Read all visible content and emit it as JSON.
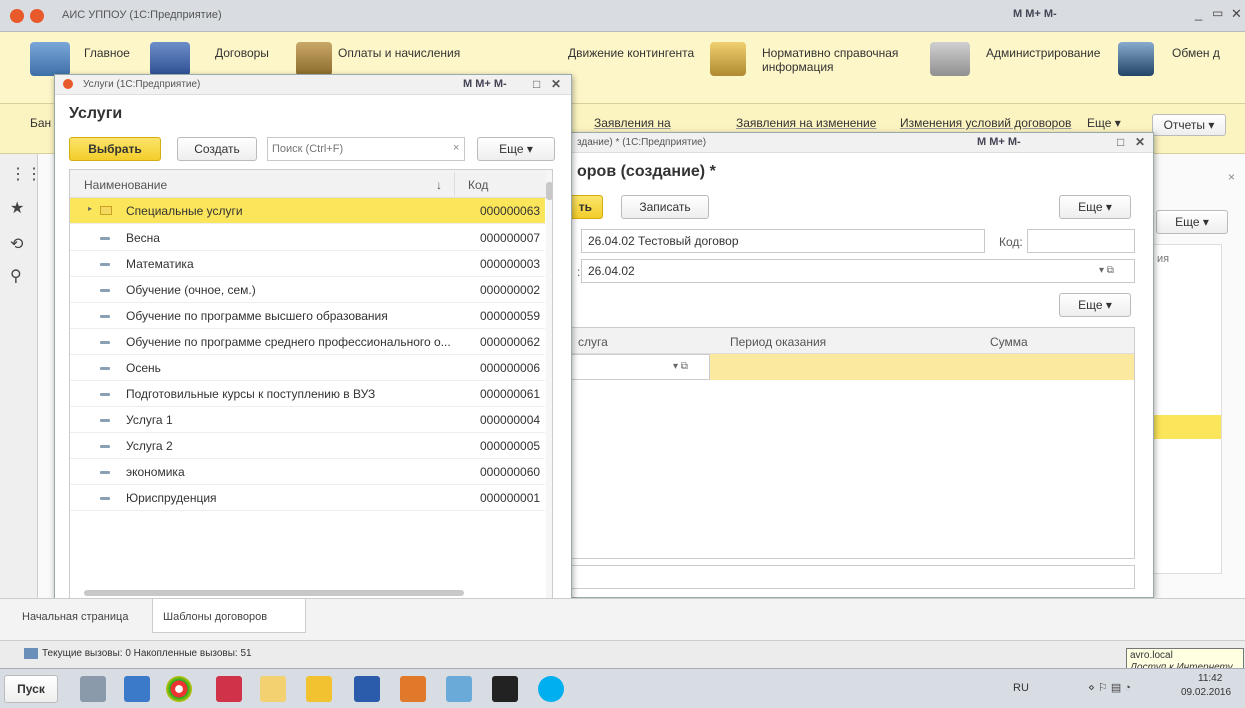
{
  "app": {
    "title": "АИС УППОУ (1С:Предприятие)",
    "toolbar_mm": "M  M+ M-"
  },
  "sections": [
    {
      "label": "Главное"
    },
    {
      "label": "Договоры"
    },
    {
      "label": "Оплаты и начисления"
    },
    {
      "label": "Движение контингента"
    },
    {
      "label": "Нормативно справочная информация"
    },
    {
      "label": "Администрирование"
    },
    {
      "label": "Обмен д"
    }
  ],
  "subbar": {
    "left_label": "Бан",
    "links": [
      "Заявления на",
      "Заявления на изменение",
      "Изменения условий договоров",
      "Еще ▾"
    ],
    "reports": "Отчеты ▾"
  },
  "bg_window": {
    "esche": "Еще ▾",
    "col_partial": "ия"
  },
  "contract_window": {
    "title": "здание) * (1С:Предприятие)",
    "heading": "оров (создание) *",
    "btn_left": "ть",
    "btn_save": "Записать",
    "esche1": "Еще ▾",
    "name_value": "26.04.02 Тестовый договор",
    "code_label": "Код:",
    "code_value": "",
    "colon_label": ":",
    "spec_value": "26.04.02",
    "esche2": "Еще ▾",
    "table_cols": [
      "слуга",
      "Период оказания",
      "Сумма"
    ]
  },
  "services_window": {
    "title": "Услуги (1С:Предприятие)",
    "heading": "Услуги",
    "select_btn": "Выбрать",
    "create_btn": "Создать",
    "search_placeholder": "Поиск (Ctrl+F)",
    "esche": "Еще ▾",
    "col_name": "Наименование",
    "col_code": "Код",
    "sort_arrow": "↓",
    "rows": [
      {
        "name": "Специальные услуги",
        "code": "000000063",
        "folder": true,
        "selected": true
      },
      {
        "name": "Весна",
        "code": "000000007"
      },
      {
        "name": "Математика",
        "code": "000000003"
      },
      {
        "name": "Обучение (очное, сем.)",
        "code": "000000002"
      },
      {
        "name": "Обучение по программе высшего образования",
        "code": "000000059"
      },
      {
        "name": "Обучение по программе среднего профессионального о...",
        "code": "000000062"
      },
      {
        "name": "Осень",
        "code": "000000006"
      },
      {
        "name": "Подготовильные курсы к поступлению в ВУЗ",
        "code": "000000061"
      },
      {
        "name": "Услуга 1",
        "code": "000000004"
      },
      {
        "name": "Услуга 2",
        "code": "000000005"
      },
      {
        "name": "экономика",
        "code": "000000060"
      },
      {
        "name": "Юриспруденция",
        "code": "000000001"
      }
    ]
  },
  "bottom_tabs": [
    "Начальная страница",
    "Шаблоны договоров"
  ],
  "status": {
    "text": "Текущие вызовы: 0   Накопленные вызовы: 51"
  },
  "tooltip": {
    "line1": "avro.local",
    "line2": "Доступ к Интернету"
  },
  "taskbar": {
    "start": "Пуск",
    "lang": "RU",
    "time": "11:42",
    "date": "09.02.2016"
  },
  "colors": {
    "accent_yellow": "#f3cd2a",
    "selected_row": "#fbe55a",
    "section_bg": "#fdf6c8"
  }
}
